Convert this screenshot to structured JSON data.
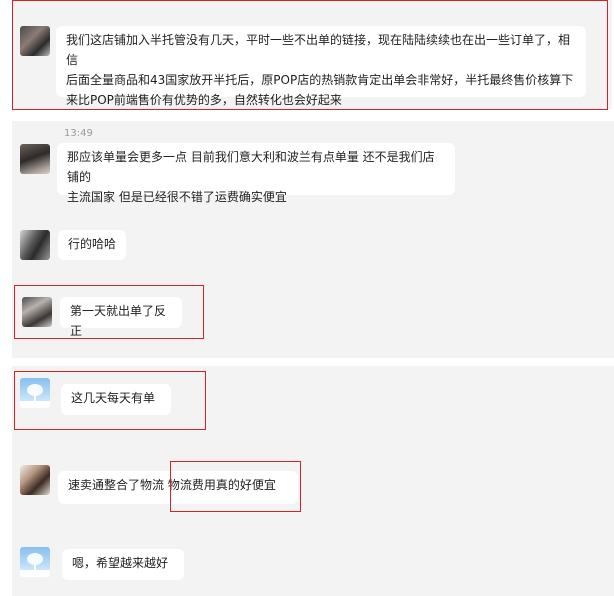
{
  "colors": {
    "panel_background": "#f3f3f3",
    "bubble_background": "#ffffff",
    "highlight_border": "#d22424",
    "timestamp_text": "#9a9a9a"
  },
  "messages": [
    {
      "avatar_icon": "blurred-avatar-icon",
      "text": "我们这店铺加入半托管没有几天，平时一些不出单的链接，现在陆陆续续也在出一些订单了，相信\n后面全量商品和43国家放开半托后，原POP店的热销款肯定出单会非常好，半托最终售价核算下\n来比POP前端售价有优势的多，自然转化也会好起来"
    },
    {
      "timestamp": "13:49",
      "avatar_icon": "blurred-avatar-icon",
      "text": "那应该单量会更多一点 目前我们意大利和波兰有点单量 还不是我们店铺的\n主流国家 但是已经很不错了运费确实便宜"
    },
    {
      "avatar_icon": "blurred-avatar-icon",
      "text": "行的哈哈"
    },
    {
      "avatar_icon": "blurred-avatar-icon",
      "text": "第一天就出单了反正"
    },
    {
      "avatar_icon": "snow-tree-avatar-icon",
      "text": "这几天每天有单"
    },
    {
      "avatar_icon": "person-photo-avatar-icon",
      "text": "速卖通整合了物流 物流费用真的好便宜"
    },
    {
      "avatar_icon": "snow-tree-avatar-icon",
      "text": "嗯，希望越来越好"
    }
  ]
}
